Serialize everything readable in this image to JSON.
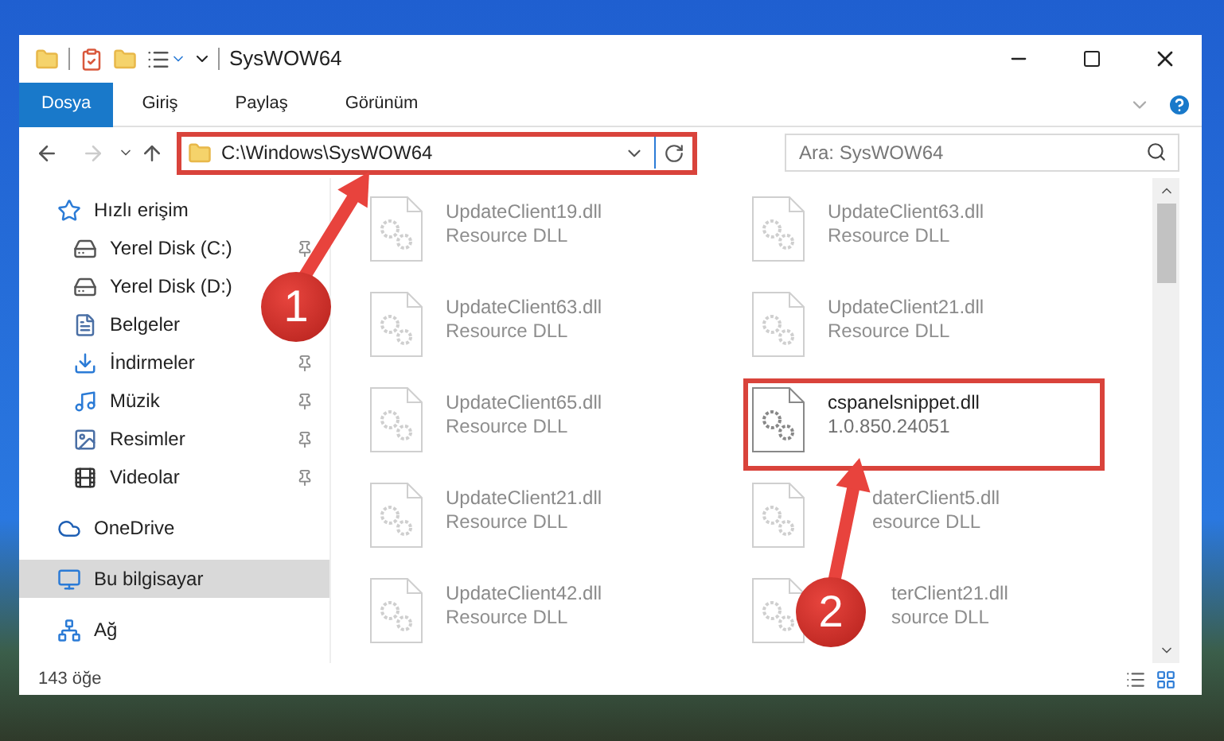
{
  "window": {
    "title": "SysWOW64"
  },
  "ribbon_tabs": [
    {
      "label": "Dosya",
      "selected": true
    },
    {
      "label": "Giriş",
      "selected": false
    },
    {
      "label": "Paylaş",
      "selected": false
    },
    {
      "label": "Görünüm",
      "selected": false
    }
  ],
  "address": {
    "path": "C:\\Windows\\SysWOW64",
    "highlighted": true
  },
  "search": {
    "placeholder": "Ara: SysWOW64"
  },
  "sidebar": {
    "items": [
      {
        "label": "Hızlı erişim",
        "kind": "star",
        "selected": false,
        "children": [
          {
            "label": "Yerel Disk (C:)",
            "kind": "system-drive",
            "selected": false,
            "pinned": true
          },
          {
            "label": "Yerel Disk (D:)",
            "kind": "drive",
            "selected": false
          },
          {
            "label": "Belgeler",
            "kind": "documents",
            "selected": false
          },
          {
            "label": "İndirmeler",
            "kind": "downloads",
            "selected": false,
            "pinned": true
          },
          {
            "label": "Müzik",
            "kind": "music",
            "selected": false,
            "pinned": true
          },
          {
            "label": "Resimler",
            "kind": "pictures",
            "selected": false,
            "pinned": true
          },
          {
            "label": "Videolar",
            "kind": "videos",
            "selected": false,
            "pinned": true
          }
        ]
      },
      {
        "label": "OneDrive",
        "kind": "cloud",
        "selected": false
      },
      {
        "label": "Bu bilgisayar",
        "kind": "computer",
        "selected": true
      },
      {
        "label": "Ağ",
        "kind": "network",
        "selected": false
      }
    ]
  },
  "files": [
    {
      "name": "UpdateClient19.dll",
      "detail": "Resource DLL",
      "highlighted": false
    },
    {
      "name": "UpdateClient63.dll",
      "detail": "Resource DLL",
      "highlighted": false
    },
    {
      "name": "UpdateClient63.dll",
      "detail": "Resource DLL",
      "highlighted": false
    },
    {
      "name": "UpdateClient21.dll",
      "detail": "Resource DLL",
      "highlighted": false
    },
    {
      "name": "UpdateClient65.dll",
      "detail": "Resource DLL",
      "highlighted": false
    },
    {
      "name": "cspanelsnippet.dll",
      "detail": "1.0.850.24051",
      "highlighted": true
    },
    {
      "name": "UpdateClient21.dll",
      "detail": "Resource DLL",
      "highlighted": false
    },
    {
      "name": "daterClient5.dll",
      "detail": "esource DLL",
      "highlighted": false
    },
    {
      "name": "UpdateClient42.dll",
      "detail": "Resource DLL",
      "highlighted": false
    },
    {
      "name": "terClient21.dll",
      "detail": "source DLL",
      "highlighted": false
    }
  ],
  "status_bar": {
    "item_count": "143 öğe"
  },
  "annotations": [
    {
      "label": "1"
    },
    {
      "label": "2"
    }
  ]
}
